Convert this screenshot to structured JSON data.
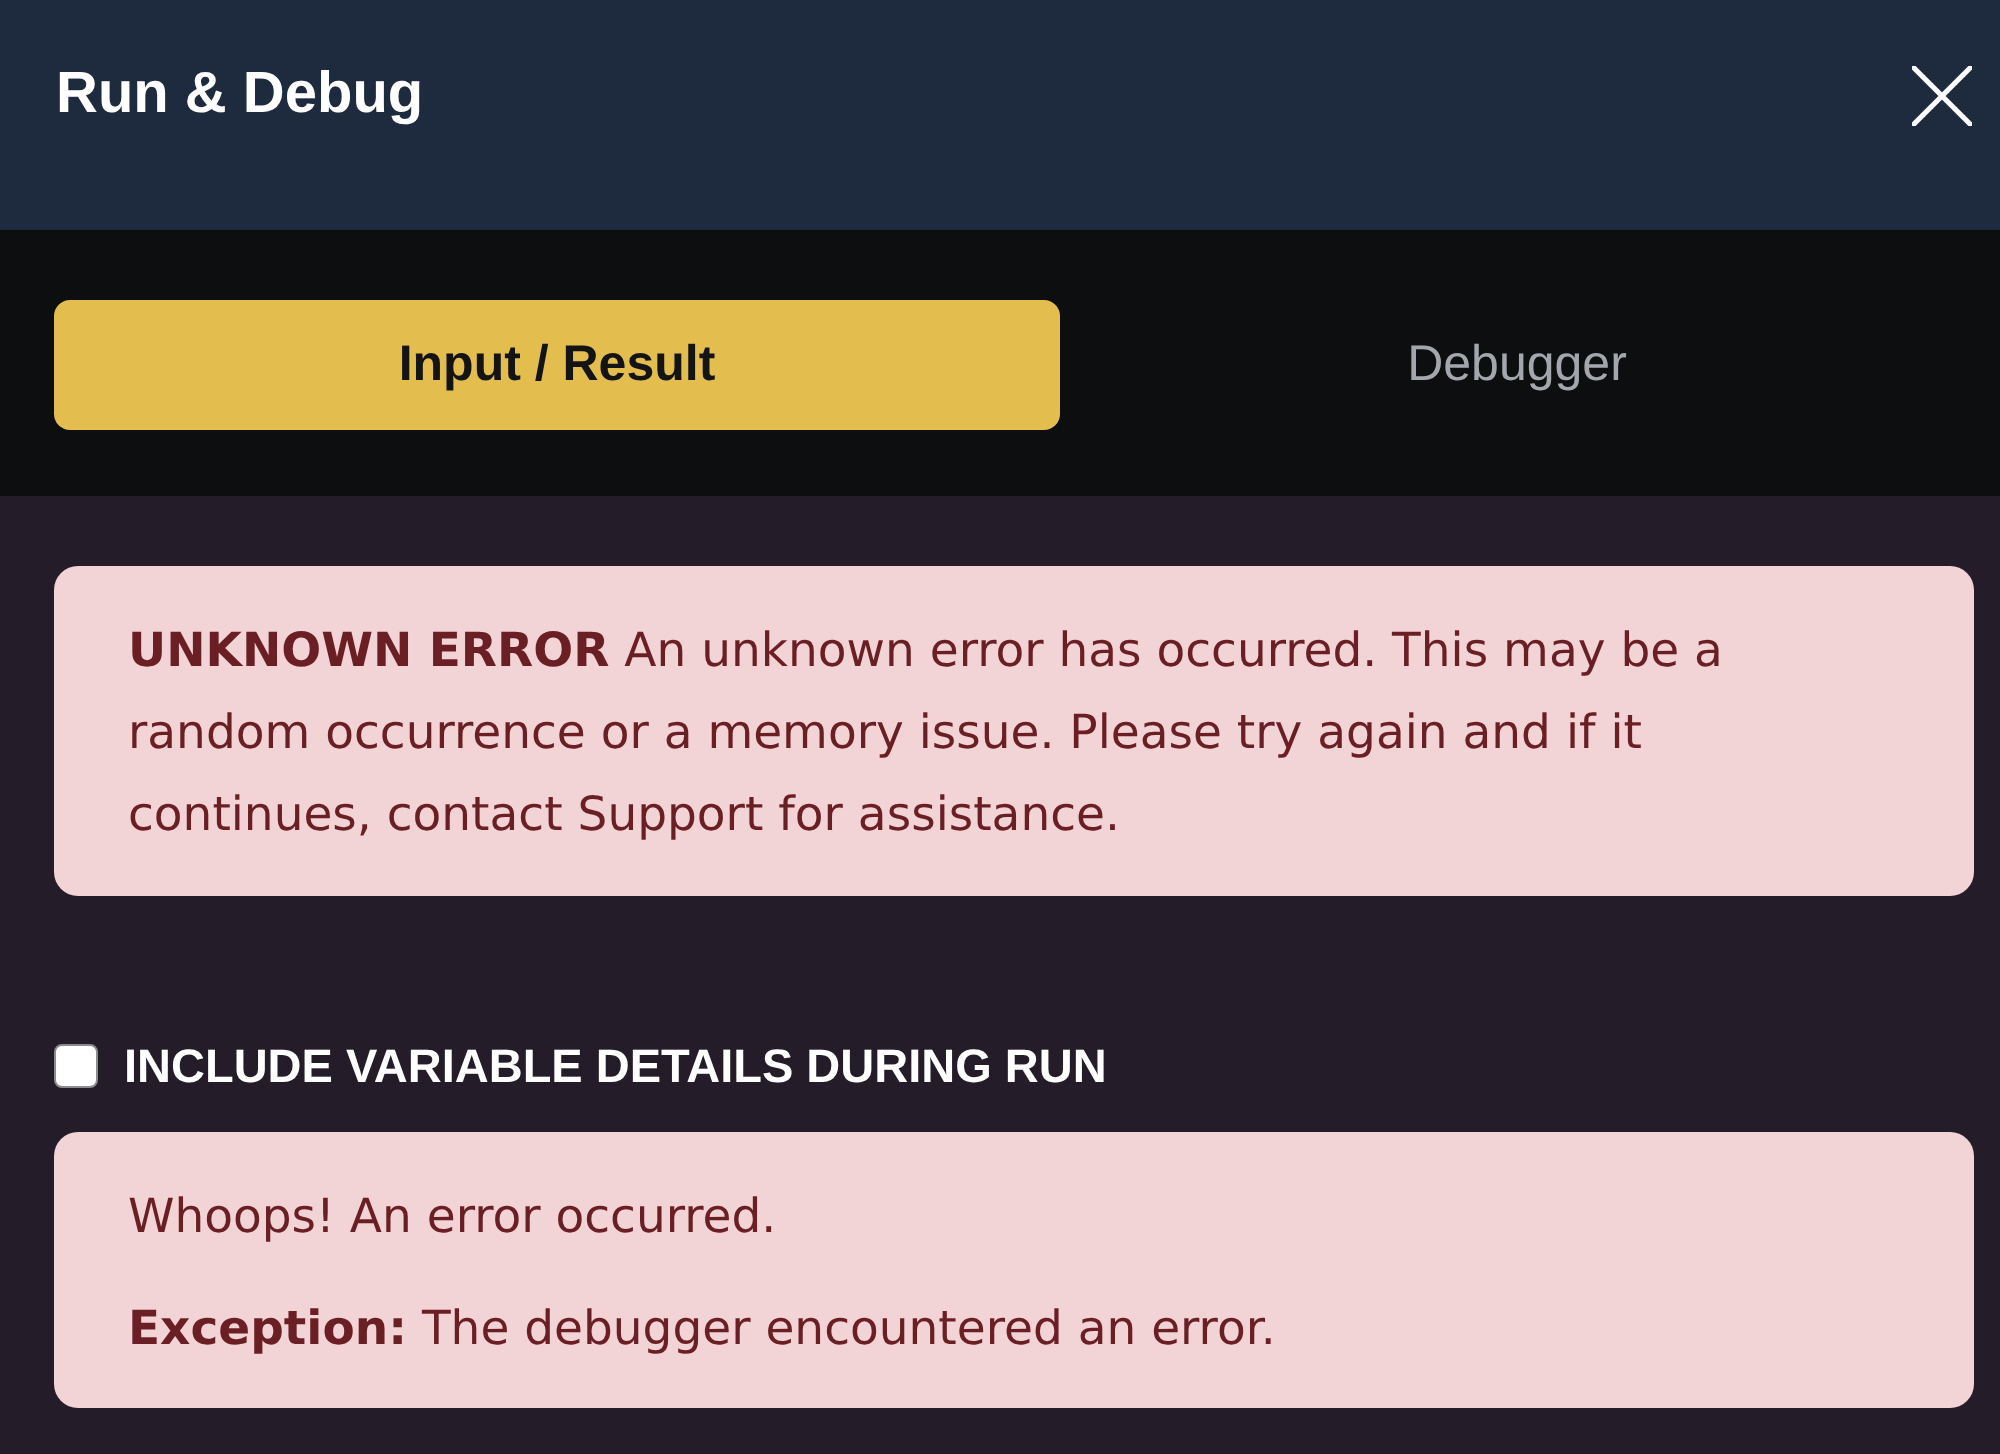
{
  "window": {
    "title": "Run & Debug"
  },
  "tabs": [
    {
      "label": "Input / Result",
      "selected": true
    },
    {
      "label": "Debugger",
      "selected": false
    }
  ],
  "error_alert": {
    "text": "**UNKNOWN ERROR** An unknown error has occurred. This may be a random occurrence or a memory issue. Please try again and if it continues, contact Support for assistance."
  },
  "include_variable_details": {
    "label": "INCLUDE VARIABLE DETAILS DURING RUN",
    "checked": false
  },
  "debug_output": {
    "lines": [
      "Whoops! An error occurred.",
      "**Exception:** The debugger encountered an error."
    ]
  }
}
